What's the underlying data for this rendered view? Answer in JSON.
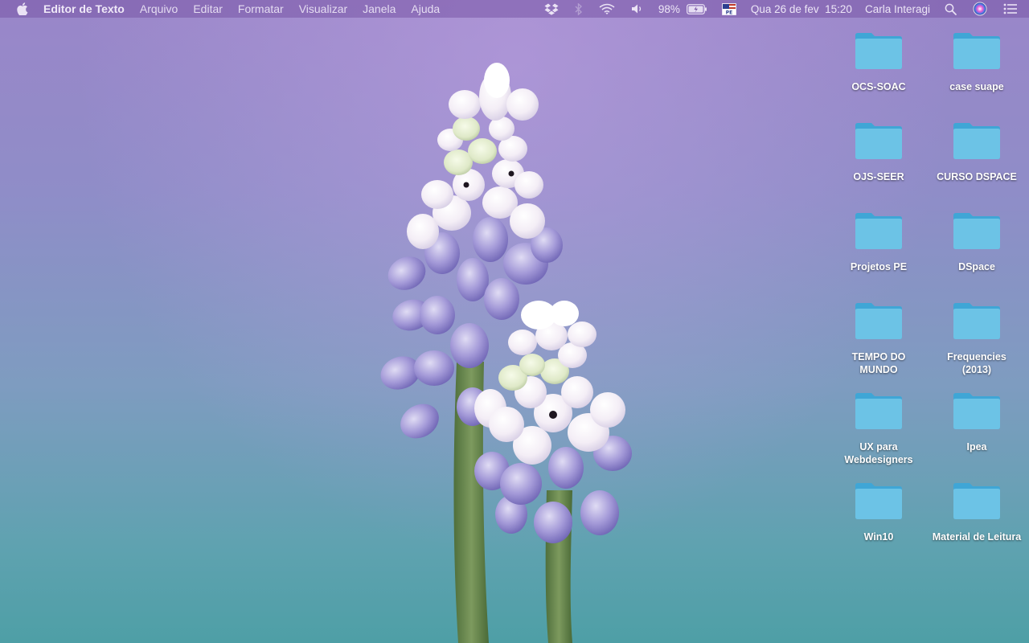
{
  "menubar": {
    "app_name": "Editor de Texto",
    "menus": [
      "Arquivo",
      "Editar",
      "Formatar",
      "Visualizar",
      "Janela",
      "Ajuda"
    ],
    "battery": "98%",
    "input_source": "PE",
    "datetime": "Qua 26 de fev  15:20",
    "user": "Carla Interagi"
  },
  "desktop": {
    "folders": [
      "OCS-SOAC",
      "case suape",
      "OJS-SEER",
      "CURSO DSPACE",
      "Projetos PE",
      "DSpace",
      "TEMPO DO MUNDO",
      "Frequencies (2013)",
      "UX para Webdesigners",
      "Ipea",
      "Win10",
      "Material de Leitura"
    ]
  },
  "colors": {
    "folder_light": "#6cc3e6",
    "folder_dark": "#3fa6d6",
    "menubar": "#7855a5",
    "wallpaper_top": "#9a86c9",
    "wallpaper_bottom": "#4e9fa6"
  }
}
